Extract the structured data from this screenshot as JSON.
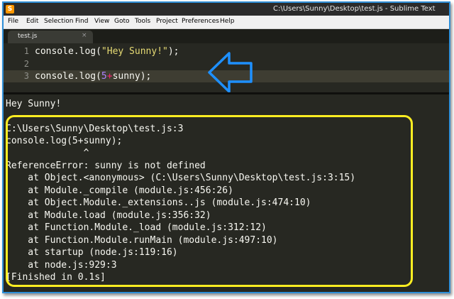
{
  "window": {
    "title": "C:\\Users\\Sunny\\Desktop\\test.js - Sublime Text",
    "app_icon_glyph": "S"
  },
  "menu": {
    "items": [
      "File",
      "Edit",
      "Selection",
      "Find",
      "View",
      "Goto",
      "Tools",
      "Project",
      "Preferences",
      "Help"
    ]
  },
  "tabs": {
    "active_label": "test.js",
    "close_glyph": "×"
  },
  "editor": {
    "line_numbers": [
      "1",
      "2",
      "3"
    ],
    "current_line": 3,
    "lines": [
      {
        "prefix": "console.log(",
        "str": "\"Hey Sunny!\"",
        "suffix": ");"
      },
      {
        "prefix": "",
        "str": "",
        "suffix": ""
      },
      {
        "prefix": "console.log(",
        "num": "5",
        "op": "+",
        "suffix": "sunny);"
      }
    ]
  },
  "output": {
    "lines": [
      "Hey Sunny!",
      "",
      "C:\\Users\\Sunny\\Desktop\\test.js:3",
      "console.log(5+sunny);",
      "              ^",
      "ReferenceError: sunny is not defined",
      "    at Object.<anonymous> (C:\\Users\\Sunny\\Desktop\\test.js:3:15)",
      "    at Module._compile (module.js:456:26)",
      "    at Object.Module._extensions..js (module.js:474:10)",
      "    at Module.load (module.js:356:32)",
      "    at Function.Module._load (module.js:312:12)",
      "    at Function.Module.runMain (module.js:497:10)",
      "    at startup (node.js:119:16)",
      "    at node.js:929:3",
      "[Finished in 0.1s]"
    ]
  },
  "annotations": {
    "arrow_icon": "left-arrow-outline-icon",
    "arrow_color": "#1e90ff",
    "highlight_color": "#ffee22"
  },
  "theme": {
    "background": "#272822",
    "foreground": "#f8f8f2",
    "string": "#e6db74",
    "number": "#ae81ff",
    "operator": "#f92672",
    "frame_border": "#2f8fd8"
  }
}
